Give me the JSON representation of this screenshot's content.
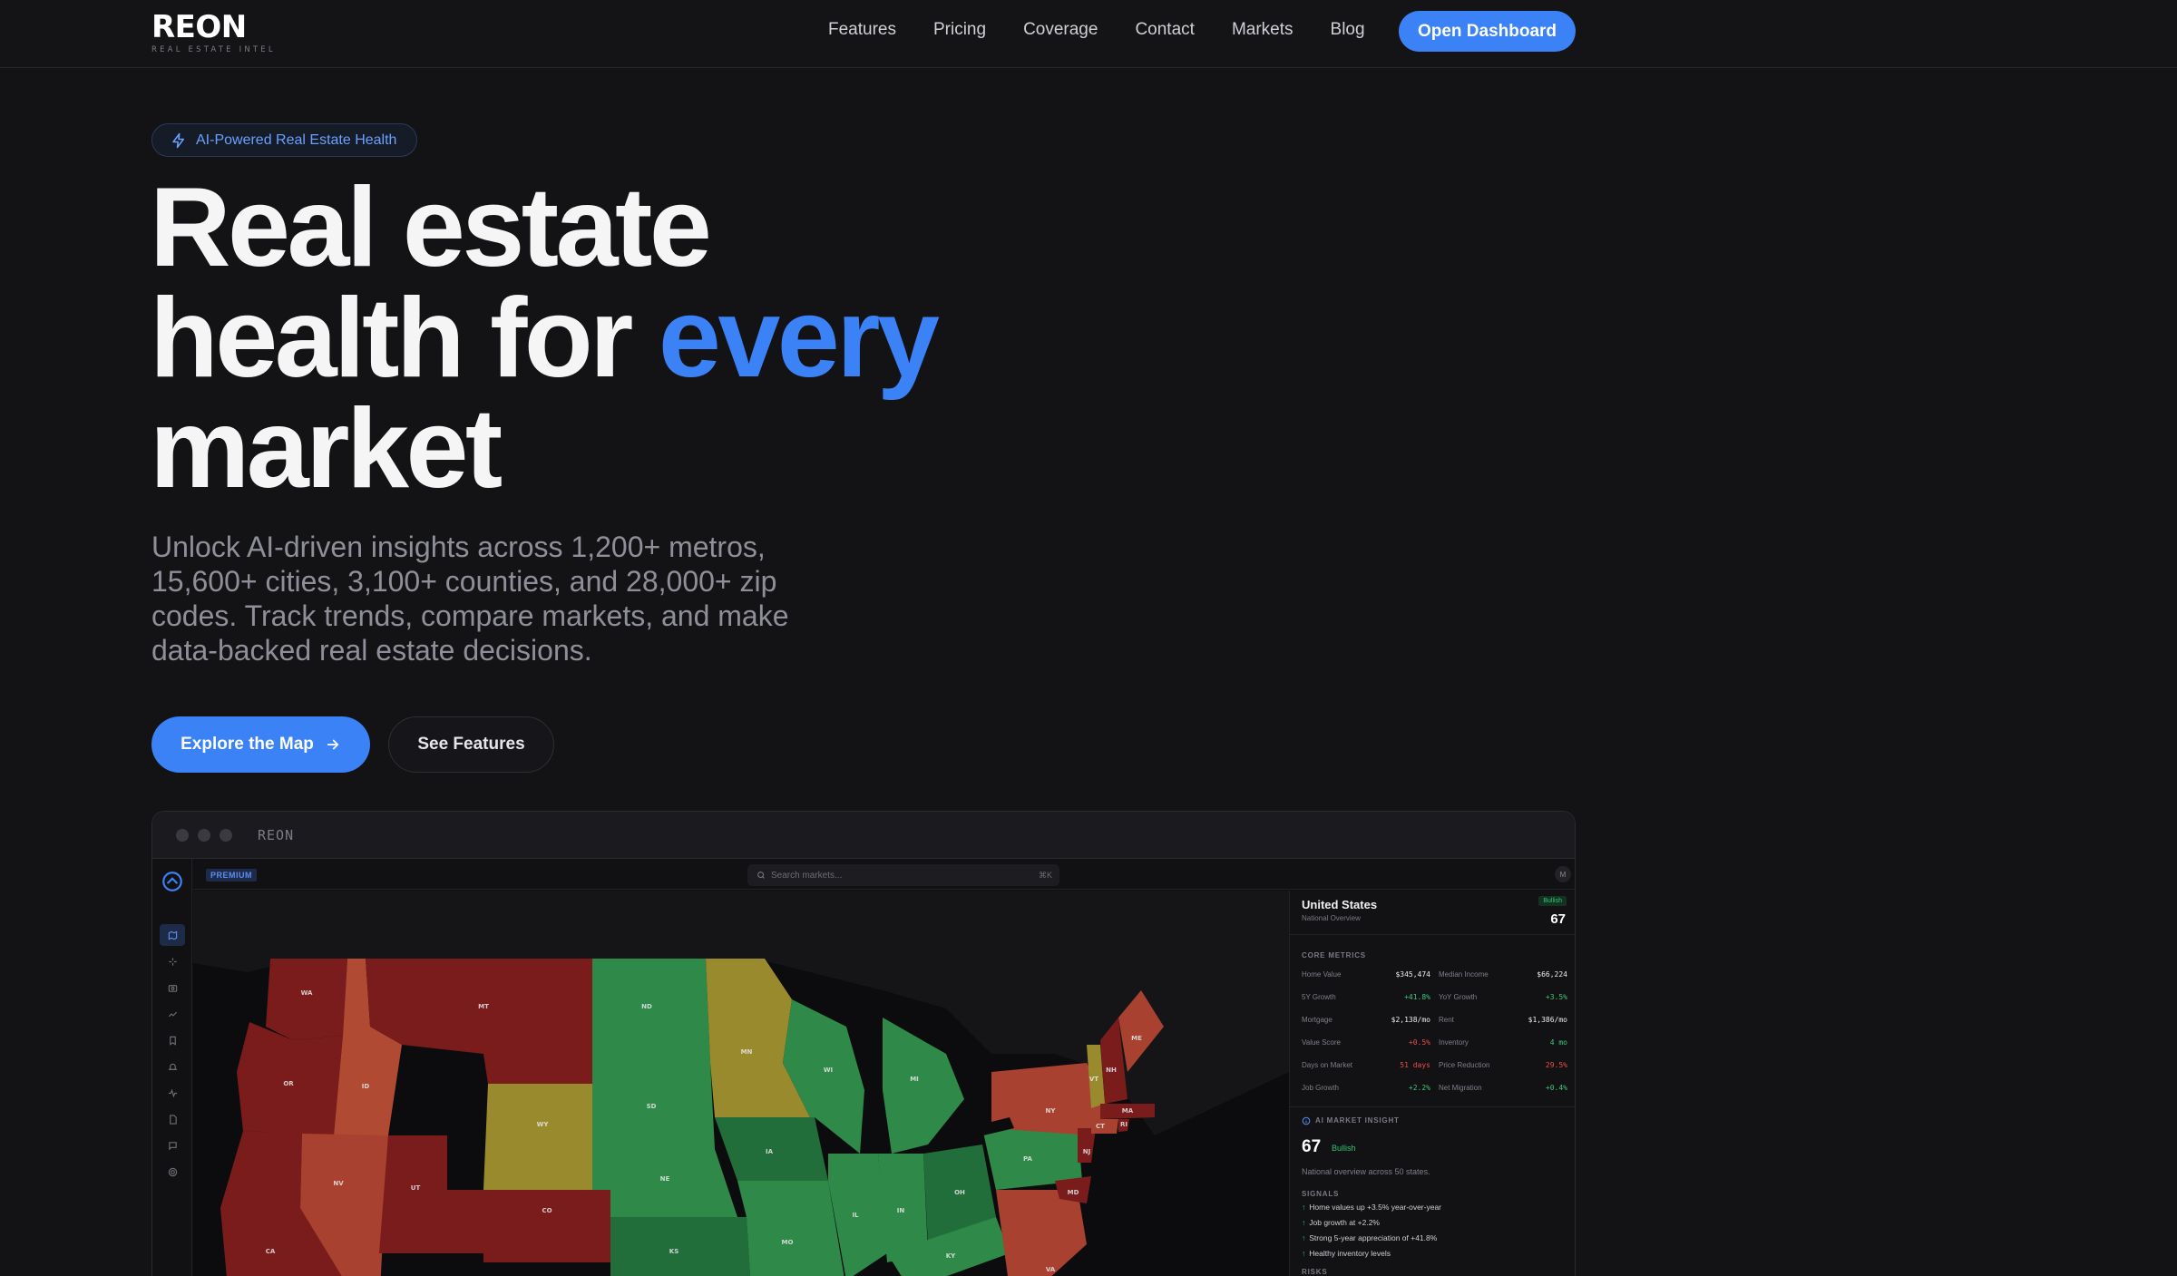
{
  "brand": {
    "name": "REON",
    "tagline": "REAL ESTATE INTEL"
  },
  "nav": {
    "links": [
      "Features",
      "Pricing",
      "Coverage",
      "Contact",
      "Markets",
      "Blog"
    ],
    "cta": "Open Dashboard"
  },
  "hero": {
    "badge": "AI-Powered Real Estate Health",
    "headline_line1": "Real estate",
    "headline_line2_start": "health for ",
    "headline_accent": "every",
    "headline_line3": "market",
    "subtext": "Unlock AI-driven insights across 1,200+ metros, 15,600+ cities, 3,100+ counties, and 28,000+ zip codes. Track trends, compare markets, and make data-backed real estate decisions.",
    "primary_cta": "Explore the Map",
    "secondary_cta": "See Features"
  },
  "preview": {
    "window_title": "REON",
    "plan_badge": "PREMIUM",
    "search_placeholder": "Search markets...",
    "search_shortcut": "⌘K",
    "avatar_initial": "M",
    "sidebar_icons": [
      "map-icon",
      "sparkle-icon",
      "camera-icon",
      "trend-icon",
      "bookmark-icon",
      "bell-icon",
      "pulse-icon",
      "document-icon",
      "chat-icon",
      "settings-icon"
    ],
    "map_states": [
      "WA",
      "OR",
      "CA",
      "ID",
      "NV",
      "MT",
      "WY",
      "UT",
      "CO",
      "ND",
      "SD",
      "NE",
      "KS",
      "MN",
      "IA",
      "MO",
      "WI",
      "IL",
      "MI",
      "IN",
      "OH",
      "KY",
      "PA",
      "NY",
      "VA",
      "ME",
      "VT",
      "NH",
      "MA",
      "CT",
      "RI",
      "NJ",
      "MD"
    ],
    "panel": {
      "country": "United States",
      "scope": "National Overview",
      "sentiment": "Bullish",
      "score": "67",
      "core_heading": "CORE METRICS",
      "metrics": [
        {
          "label": "Home Value",
          "value": "$345,474",
          "tone": "neutral"
        },
        {
          "label": "Median Income",
          "value": "$66,224",
          "tone": "neutral"
        },
        {
          "label": "5Y Growth",
          "value": "+41.8%",
          "tone": "pos"
        },
        {
          "label": "YoY Growth",
          "value": "+3.5%",
          "tone": "pos"
        },
        {
          "label": "Mortgage",
          "value": "$2,138/mo",
          "tone": "neutral"
        },
        {
          "label": "Rent",
          "value": "$1,386/mo",
          "tone": "neutral"
        },
        {
          "label": "Value Score",
          "value": "+0.5%",
          "tone": "neg"
        },
        {
          "label": "Inventory",
          "value": "4 mo",
          "tone": "pos"
        },
        {
          "label": "Days on Market",
          "value": "51 days",
          "tone": "neg"
        },
        {
          "label": "Price Reduction",
          "value": "29.5%",
          "tone": "neg"
        },
        {
          "label": "Job Growth",
          "value": "+2.2%",
          "tone": "pos"
        },
        {
          "label": "Net Migration",
          "value": "+0.4%",
          "tone": "pos"
        }
      ],
      "ai_heading": "AI MARKET INSIGHT",
      "ai_score": "67",
      "ai_sentiment": "Bullish",
      "ai_summary": "National overview across 50 states.",
      "signals_heading": "SIGNALS",
      "signals": [
        "Home values up +3.5% year-over-year",
        "Job growth at +2.2%",
        "Strong 5-year appreciation of +41.8%",
        "Healthy inventory levels"
      ],
      "risks_heading": "RISKS"
    }
  },
  "colors": {
    "accent": "#3b82f6",
    "background": "#131316",
    "bullish_green": "#2f8a4a",
    "neutral_olive": "#9a8a2e",
    "bearish_red": "#7a1c1c",
    "warning_orange": "#b04a33"
  }
}
